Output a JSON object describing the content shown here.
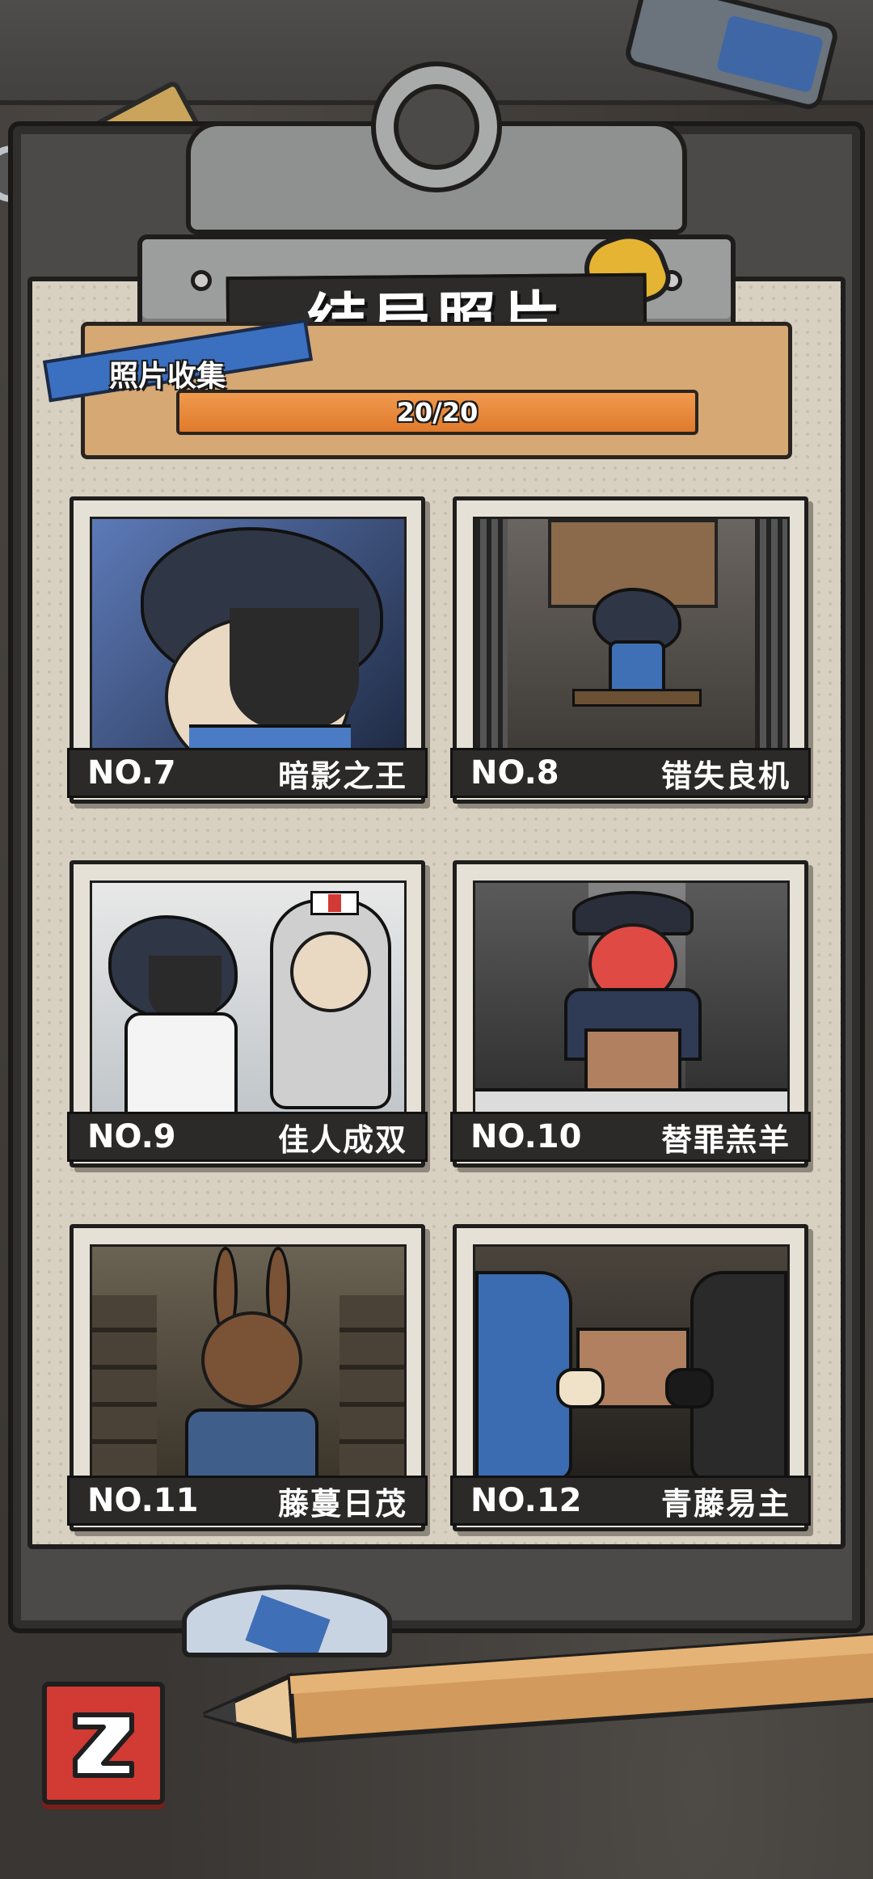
{
  "screen": {
    "title": "结局照片",
    "collection_label": "照片收集",
    "progress": {
      "current": 20,
      "total": 20,
      "text": "20/20"
    }
  },
  "photos": [
    {
      "no": "NO.7",
      "name": "暗影之王",
      "scene": "shadow-portrait"
    },
    {
      "no": "NO.8",
      "name": "错失良机",
      "scene": "cell-bench"
    },
    {
      "no": "NO.9",
      "name": "佳人成双",
      "scene": "lab-nurse"
    },
    {
      "no": "NO.10",
      "name": "替罪羔羊",
      "scene": "officer-box"
    },
    {
      "no": "NO.11",
      "name": "藤蔓日茂",
      "scene": "rabbit-mask"
    },
    {
      "no": "NO.12",
      "name": "青藤易主",
      "scene": "box-handoff"
    }
  ],
  "colors": {
    "progress_fill": "#e07a2c",
    "caption_bg": "#2b2a29",
    "back_button": "#d23a34",
    "paper": "#d8d1c2"
  },
  "icons": {
    "back": "back-arrow-icon"
  }
}
